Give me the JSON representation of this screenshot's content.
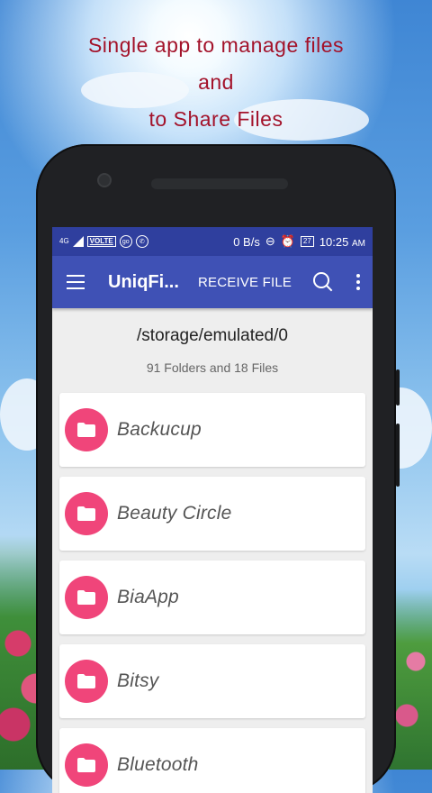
{
  "promo": {
    "line1": "Single app to manage files",
    "line2": "and",
    "line3": "to Share Files",
    "color": "#a3122a"
  },
  "status_bar": {
    "network": "4G",
    "volte": "VOLTE",
    "go_icon_label": "go",
    "speed": "0 B/s",
    "battery": "27",
    "time": "10:25",
    "ampm": "AM",
    "icons": [
      "signal-icon",
      "volte-icon",
      "go-icon",
      "whatsapp-icon",
      "do-not-disturb-icon",
      "alarm-icon",
      "battery-icon"
    ]
  },
  "toolbar": {
    "title": "UniqFi...",
    "receive_label": "RECEIVE FILE",
    "menu_icon": "hamburger-icon",
    "search_icon": "search-icon",
    "more_icon": "more-vert-icon",
    "color": "#3f51b5"
  },
  "location": {
    "path": "/storage/emulated/0",
    "counts": "91 Folders and 18 Files"
  },
  "folders": [
    {
      "name": "Backucup"
    },
    {
      "name": "Beauty Circle"
    },
    {
      "name": "BiaApp"
    },
    {
      "name": "Bitsy"
    },
    {
      "name": "Bluetooth"
    }
  ],
  "accent_color": "#f0457a"
}
